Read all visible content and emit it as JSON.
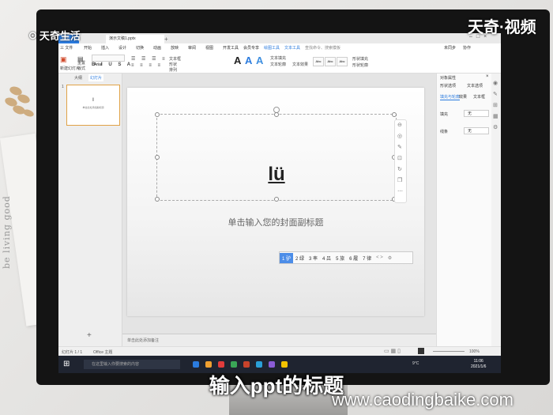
{
  "watermark": {
    "brand_left": "天奇生活",
    "brand_right": "天奇·视频",
    "website": "www.caodingbaike.com"
  },
  "caption": "输入ppt的标题",
  "background": {
    "paper_text": "be living   good"
  },
  "app": {
    "home_tab": "首页",
    "doc_tab": "演示文稿1.pptx",
    "menus": [
      "三 文件",
      "开始",
      "插入",
      "设计",
      "切换",
      "动画",
      "放映",
      "审阅",
      "视图",
      "开发工具",
      "会员专享",
      "绘图工具",
      "文本工具"
    ],
    "search_placeholder": "查找命令、搜索模板",
    "share": "未同步",
    "collab": "协作",
    "ribbon": {
      "new_slide": "新建幻灯片",
      "layout": "版式",
      "reset": "重置",
      "section": "节",
      "font_value": "Arial",
      "text_box": "文本框",
      "shape": "形状",
      "arrange": "排列",
      "wordart_labels": [
        "A",
        "A",
        "A"
      ],
      "fill": "文本填充",
      "outline": "文本轮廓",
      "effects": "文本效果",
      "style_boxes": [
        "Abc",
        "Abc",
        "Abc"
      ],
      "shape_fill": "形状填充",
      "shape_outline": "形状轮廓"
    }
  },
  "left_panel": {
    "tabs": [
      "大纲",
      "幻灯片"
    ],
    "slide_number": "1",
    "thumb_title": "I",
    "thumb_sub": "单击此处添加副标题",
    "add": "+"
  },
  "slide": {
    "title_text": "lü",
    "subtitle_placeholder": "单击输入您的封面副标题",
    "notes_placeholder": "单击此处添加备注"
  },
  "ime": {
    "candidates": [
      "1 驴",
      "2 绿",
      "3 率",
      "4 吕",
      "5 旅",
      "6 履",
      "7 律"
    ],
    "more": "< >"
  },
  "right_panel": {
    "title": "对象属性",
    "tabs": [
      "形状选项",
      "文本选项"
    ],
    "subtabs": [
      "填充与轮廓",
      "效果",
      "文本框"
    ],
    "fill_label": "填充",
    "fill_value": "无",
    "line_label": "线条",
    "line_value": "无"
  },
  "status": {
    "slide_info": "幻灯片 1 / 1",
    "theme": "Office 主题",
    "zoom": "100%"
  },
  "taskbar": {
    "search_placeholder": "在这里输入你要搜索的内容",
    "time": "11:06",
    "date": "2021/1/6",
    "weather": "9°C",
    "icon_colors": [
      "#2b7bde",
      "#f0a030",
      "#e23c3c",
      "#3aa657",
      "#c8432b",
      "#2aa0d8",
      "#8a5cd6",
      "#f2c200"
    ]
  }
}
